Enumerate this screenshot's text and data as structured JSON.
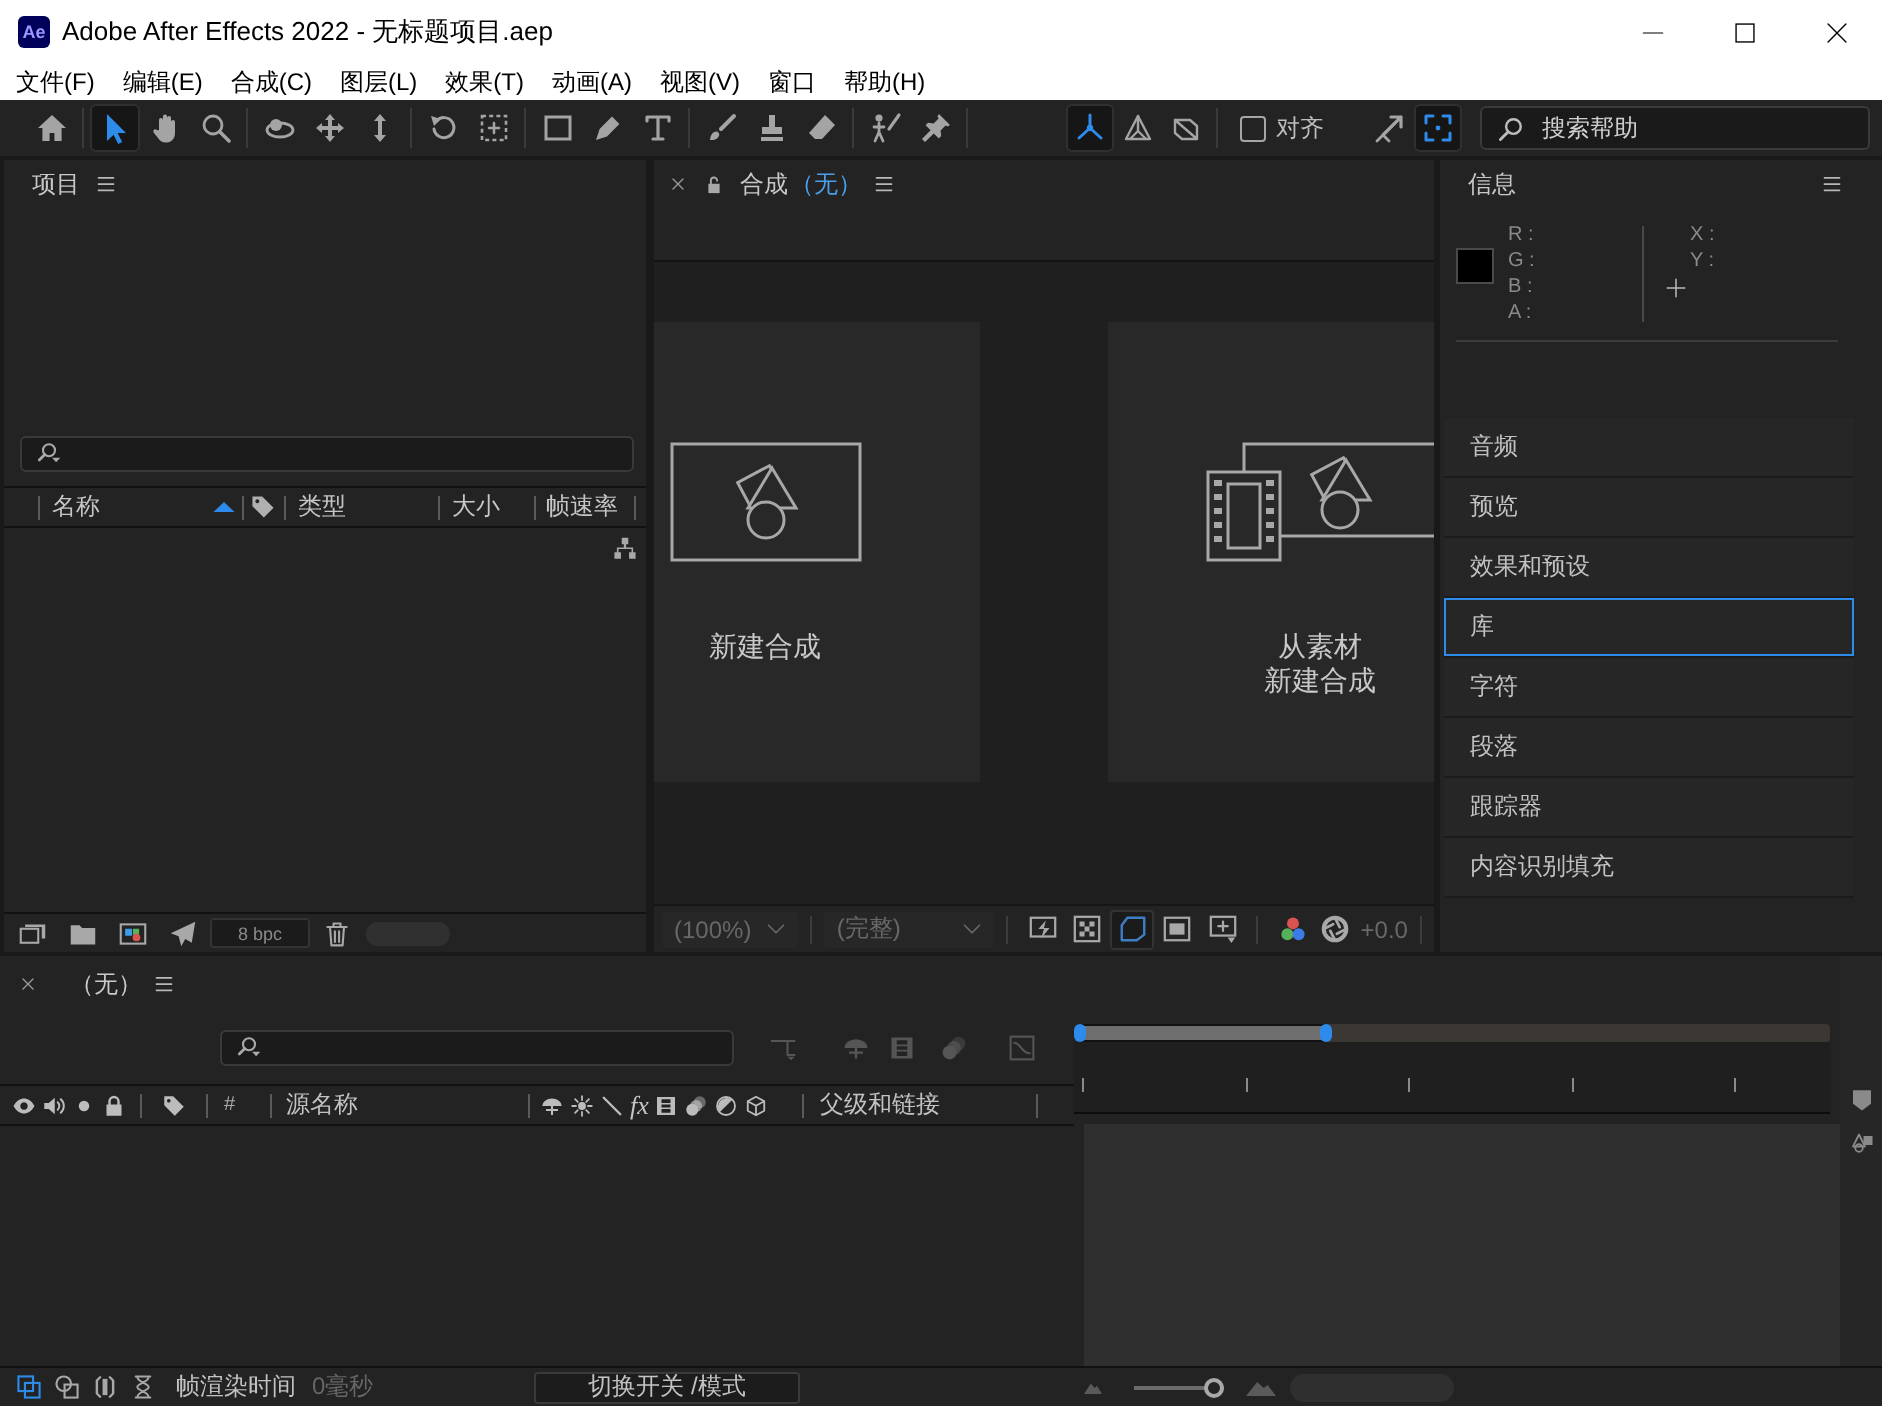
{
  "window": {
    "logo": "Ae",
    "title": "Adobe After Effects 2022 - 无标题项目.aep"
  },
  "menu": [
    "文件(F)",
    "编辑(E)",
    "合成(C)",
    "图层(L)",
    "效果(T)",
    "动画(A)",
    "视图(V)",
    "窗口",
    "帮助(H)"
  ],
  "toolbar": {
    "tool_groups": [
      [
        {
          "kind": "home",
          "selected": false
        }
      ],
      [
        {
          "kind": "selection",
          "selected": true
        },
        {
          "kind": "hand",
          "selected": false
        },
        {
          "kind": "zoom",
          "selected": false
        }
      ],
      [
        {
          "kind": "orbit",
          "selected": false
        },
        {
          "kind": "pan",
          "selected": false
        },
        {
          "kind": "dolly",
          "selected": false
        }
      ],
      [
        {
          "kind": "rotate",
          "selected": false
        },
        {
          "kind": "anchor",
          "selected": false
        }
      ],
      [
        {
          "kind": "shape",
          "selected": false
        },
        {
          "kind": "pen",
          "selected": false
        },
        {
          "kind": "type",
          "selected": false
        }
      ],
      [
        {
          "kind": "brush",
          "selected": false
        },
        {
          "kind": "stamp",
          "selected": false
        },
        {
          "kind": "eraser",
          "selected": false
        }
      ],
      [
        {
          "kind": "roto",
          "selected": false
        },
        {
          "kind": "puppet",
          "selected": false
        }
      ]
    ],
    "axes": [
      {
        "kind": "local",
        "selected": true
      },
      {
        "kind": "world",
        "selected": false
      },
      {
        "kind": "view",
        "selected": false
      }
    ],
    "snapping": {
      "label": "对齐",
      "checked": false
    },
    "extras": [
      {
        "kind": "expand",
        "selected": false
      },
      {
        "kind": "frame",
        "selected": true
      }
    ],
    "search": {
      "placeholder": "搜索帮助"
    }
  },
  "project_panel": {
    "title": "项目",
    "columns": [
      {
        "kind": "text",
        "label": "名称",
        "sorted": true
      },
      {
        "kind": "tag",
        "sorted": false
      },
      {
        "kind": "text",
        "label": "类型",
        "sorted": false
      },
      {
        "kind": "text",
        "label": "大小",
        "sorted": false
      },
      {
        "kind": "text",
        "label": "帧速率",
        "sorted": false
      }
    ],
    "bit_depth": "8 bpc"
  },
  "composition_panel": {
    "title": "合成",
    "name": "（无）",
    "actions": [
      {
        "kind": "new_composition",
        "lines": [
          "新建合成"
        ]
      },
      {
        "kind": "from_footage",
        "lines": [
          "从素材",
          "新建合成"
        ]
      }
    ],
    "viewer_bar": {
      "zoom": "(100%)",
      "resolution": "(完整)",
      "disabled": true,
      "toggles": [
        {
          "kind": "fast_previews",
          "selected": false
        },
        {
          "kind": "transparency_grid",
          "selected": false
        },
        {
          "kind": "mask_path",
          "selected": true
        },
        {
          "kind": "region",
          "selected": false
        },
        {
          "kind": "view_options",
          "selected": false
        }
      ],
      "exposure": "+0.0"
    }
  },
  "info_panel": {
    "title": "信息",
    "color_channels": [
      "R :",
      "G :",
      "B :",
      "A :"
    ],
    "coordinates": [
      "X :",
      "Y :"
    ]
  },
  "panels": [
    {
      "label": "音频",
      "selected": false
    },
    {
      "label": "预览",
      "selected": false
    },
    {
      "label": "效果和预设",
      "selected": false
    },
    {
      "label": "库",
      "selected": true
    },
    {
      "label": "字符",
      "selected": false
    },
    {
      "label": "段落",
      "selected": false
    },
    {
      "label": "跟踪器",
      "selected": false
    },
    {
      "label": "内容识别填充",
      "selected": false
    }
  ],
  "timeline": {
    "title": "（无）",
    "number_column": "#",
    "name_column": "源名称",
    "effects_switch": "fx",
    "parent_column": "父级和链接",
    "work_area": {
      "level": 0.33
    },
    "render_label": "帧渲染时间",
    "render_time": "0毫秒",
    "toggle_button": "切换开关 /模式",
    "zoom_slider": {
      "level": 1
    }
  }
}
